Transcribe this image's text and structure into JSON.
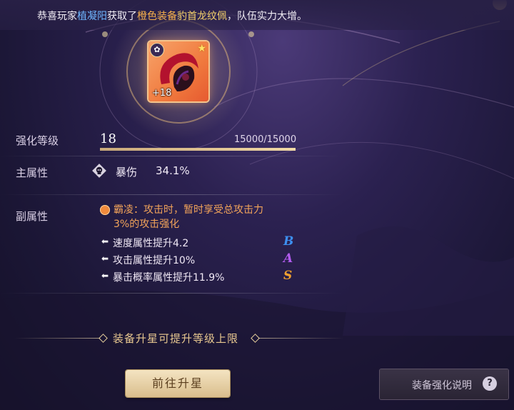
{
  "broadcast": {
    "prefix": "恭喜玩家",
    "player": "植凝阳",
    "middle": "获取了",
    "quality": "橙色装备",
    "item": "豹首龙纹佩",
    "suffix": "，队伍实力大增。"
  },
  "item": {
    "level_text": "+18",
    "icon": "dragon-pendant-icon",
    "quality_color": "#f07a3e"
  },
  "enhance": {
    "label": "强化等级",
    "level": "18",
    "exp_text": "15000/15000",
    "exp_progress": 1.0
  },
  "main_attr": {
    "label": "主属性",
    "name": "暴伤",
    "value": "34.1%"
  },
  "sub_attr": {
    "label": "副属性",
    "skill_text": "霸凌：攻击时，暂时享受总攻击力3%的攻击强化",
    "items": [
      {
        "text": "速度属性提升4.2",
        "grade": "B",
        "grade_color": "#3d8ff0"
      },
      {
        "text": "攻击属性提升10%",
        "grade": "A",
        "grade_color": "#b35cf0"
      },
      {
        "text": "暴击概率属性提升11.9%",
        "grade": "S",
        "grade_color": "#f0a030"
      }
    ]
  },
  "hint": "装备升星可提升等级上限",
  "buttons": {
    "goto_star": "前往升星",
    "help": "装备强化说明",
    "help_icon": "?"
  }
}
